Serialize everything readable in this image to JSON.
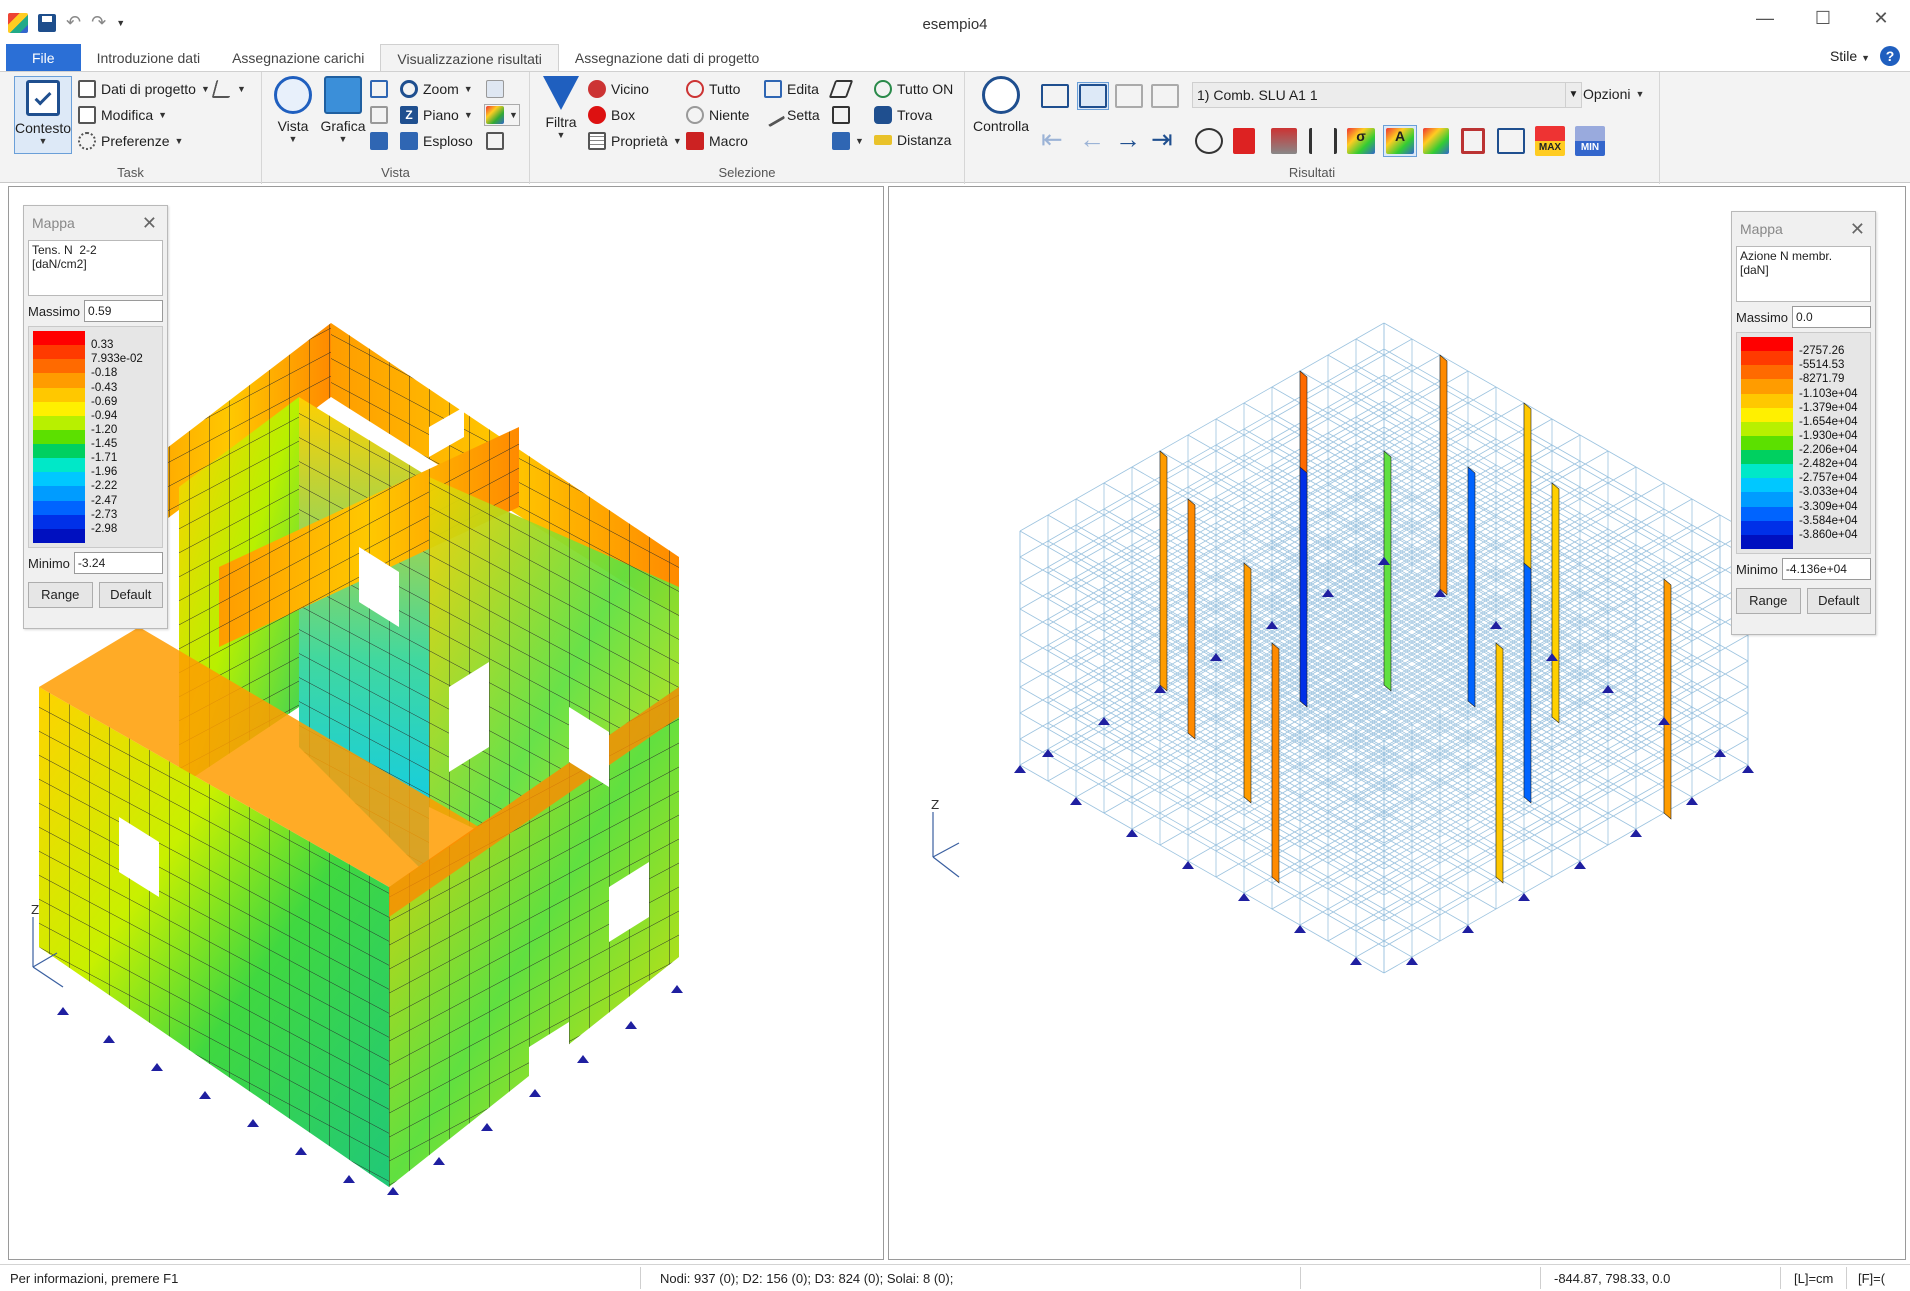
{
  "window": {
    "title": "esempio4"
  },
  "quick_access": {
    "icons": [
      "app-logo-icon",
      "save-icon",
      "undo-icon",
      "redo-icon",
      "customize-icon"
    ]
  },
  "tabs": [
    {
      "label": "File"
    },
    {
      "label": "Introduzione dati"
    },
    {
      "label": "Assegnazione carichi"
    },
    {
      "label": "Visualizzazione risultati"
    },
    {
      "label": "Assegnazione dati di progetto"
    }
  ],
  "style_menu": {
    "label": "Stile"
  },
  "ribbon": {
    "task": {
      "label": "Task",
      "contesto": "Contesto",
      "dati_progetto": "Dati di progetto",
      "modifica": "Modifica",
      "preferenze": "Preferenze"
    },
    "vista": {
      "label": "Vista",
      "vista": "Vista",
      "grafica": "Grafica",
      "zoom": "Zoom",
      "piano": "Piano",
      "esploso": "Esploso"
    },
    "selezione": {
      "label": "Selezione",
      "filtra": "Filtra",
      "vicino": "Vicino",
      "box": "Box",
      "proprieta": "Proprietà",
      "tutto": "Tutto",
      "niente": "Niente",
      "macro": "Macro",
      "edita": "Edita",
      "setta": "Setta",
      "tutto_on": "Tutto ON",
      "trova": "Trova",
      "distanza": "Distanza"
    },
    "risultati": {
      "label": "Risultati",
      "controlla": "Controlla",
      "combination": "1) Comb. SLU A1 1",
      "opzioni": "Opzioni",
      "max_label": "MAX",
      "min_label": "MIN"
    }
  },
  "left_map": {
    "title": "Mappa",
    "description": "Tens. N  2-2\n[daN/cm2]",
    "max_label": "Massimo",
    "max_value": "0.59",
    "min_label": "Minimo",
    "min_value": "-3.24",
    "range_button": "Range",
    "default_button": "Default",
    "scale_labels": [
      "0.33",
      "7.933e-02",
      "-0.18",
      "-0.43",
      "-0.69",
      "-0.94",
      "-1.20",
      "-1.45",
      "-1.71",
      "-1.96",
      "-2.22",
      "-2.47",
      "-2.73",
      "-2.98"
    ],
    "scale_colors": [
      "#ff0000",
      "#ff3a00",
      "#ff6a00",
      "#ff9c00",
      "#ffc800",
      "#fff000",
      "#b8f000",
      "#5ce000",
      "#00d060",
      "#00e8c8",
      "#00c8ff",
      "#009cff",
      "#0064ff",
      "#0030e8",
      "#0010c0"
    ]
  },
  "right_map": {
    "title": "Mappa",
    "description": "Azione N membr.\n[daN]",
    "max_label": "Massimo",
    "max_value": "0.0",
    "min_label": "Minimo",
    "min_value": "-4.136e+04",
    "range_button": "Range",
    "default_button": "Default",
    "scale_labels": [
      "-2757.26",
      "-5514.53",
      "-8271.79",
      "-1.103e+04",
      "-1.379e+04",
      "-1.654e+04",
      "-1.930e+04",
      "-2.206e+04",
      "-2.482e+04",
      "-2.757e+04",
      "-3.033e+04",
      "-3.309e+04",
      "-3.584e+04",
      "-3.860e+04"
    ],
    "scale_colors": [
      "#ff0000",
      "#ff3a00",
      "#ff6a00",
      "#ff9c00",
      "#ffc800",
      "#fff000",
      "#b8f000",
      "#5ce000",
      "#00d060",
      "#00e8c8",
      "#00c8ff",
      "#009cff",
      "#0064ff",
      "#0030e8",
      "#0010c0"
    ]
  },
  "axis_label": "Z",
  "status": {
    "help": "Per informazioni, premere F1",
    "counts": "Nodi: 937 (0); D2: 156 (0); D3: 824 (0); Solai: 8 (0);",
    "coords": "-844.87, 798.33, 0.0",
    "units_length": "[L]=cm",
    "units_force": "[F]=("
  }
}
